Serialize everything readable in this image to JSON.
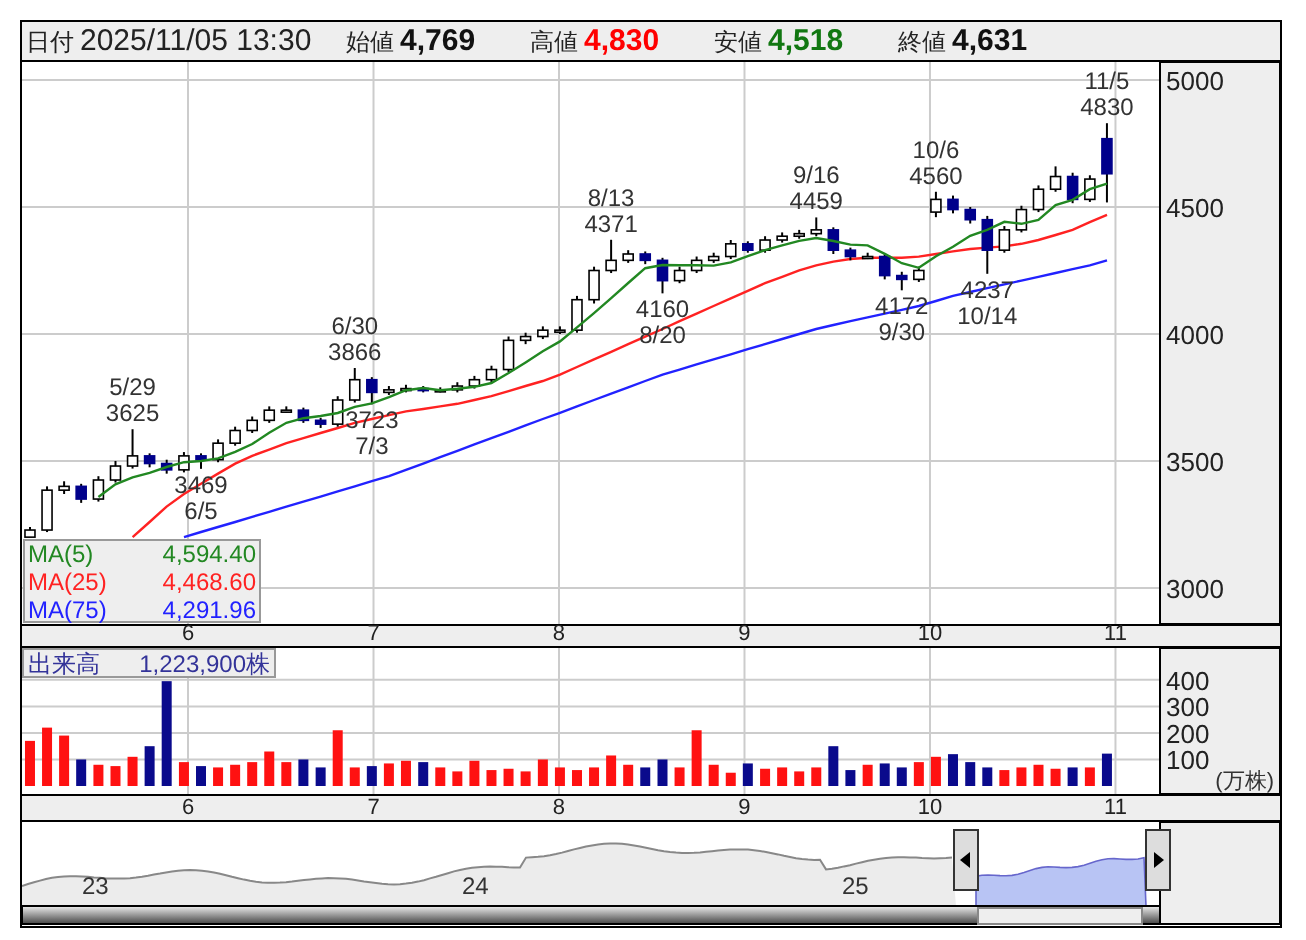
{
  "header": {
    "items": [
      {
        "kind": "date",
        "label": "日付",
        "value": "2025/11/05 13:30",
        "color": "#222222"
      },
      {
        "kind": "price",
        "label": "始値",
        "value": "4,769",
        "color": "#111111"
      },
      {
        "kind": "price",
        "label": "高値",
        "value": "4,830",
        "color": "#ff0000"
      },
      {
        "kind": "price",
        "label": "安値",
        "value": "4,518",
        "color": "#117711"
      },
      {
        "kind": "price",
        "label": "終値",
        "value": "4,631",
        "color": "#111111"
      }
    ]
  },
  "price_chart": {
    "legend_values": [
      "4,594.40",
      "4,468.60",
      "4,291.96"
    ],
    "chart_data": {
      "type": "candlestick",
      "grid": true,
      "ylim": [
        2858,
        5071
      ],
      "yticks": [
        {
          "value": 3000,
          "label": "3000"
        },
        {
          "value": 3500,
          "label": "3500"
        },
        {
          "value": 4000,
          "label": "4000"
        },
        {
          "value": 4500,
          "label": "4500"
        },
        {
          "value": 5000,
          "label": "5000"
        }
      ],
      "xlim": [
        5.105,
        11.887
      ],
      "xticks": [
        6,
        7,
        8,
        9,
        10,
        11
      ],
      "x": [
        5.148,
        5.24,
        5.332,
        5.424,
        5.517,
        5.609,
        5.701,
        5.793,
        5.885,
        5.978,
        6.07,
        6.162,
        6.254,
        6.346,
        6.438,
        6.53,
        6.622,
        6.715,
        6.807,
        6.899,
        6.991,
        7.083,
        7.175,
        7.268,
        7.36,
        7.452,
        7.544,
        7.636,
        7.728,
        7.82,
        7.913,
        8.005,
        8.097,
        8.189,
        8.281,
        8.373,
        8.465,
        8.558,
        8.65,
        8.742,
        8.834,
        8.926,
        9.018,
        9.111,
        9.203,
        9.295,
        9.387,
        9.479,
        9.571,
        9.664,
        9.756,
        9.848,
        9.94,
        10.032,
        10.124,
        10.217,
        10.309,
        10.401,
        10.493,
        10.585,
        10.677,
        10.769,
        10.862,
        10.954
      ],
      "ohlc": [
        [
          3200,
          3240,
          3200,
          3228
        ],
        [
          3228,
          3400,
          3220,
          3385
        ],
        [
          3385,
          3420,
          3370,
          3400
        ],
        [
          3400,
          3410,
          3335,
          3350
        ],
        [
          3350,
          3440,
          3340,
          3425
        ],
        [
          3425,
          3500,
          3415,
          3480
        ],
        [
          3480,
          3625,
          3470,
          3520
        ],
        [
          3520,
          3530,
          3475,
          3490
        ],
        [
          3490,
          3505,
          3450,
          3465
        ],
        [
          3465,
          3535,
          3455,
          3520
        ],
        [
          3520,
          3530,
          3469,
          3505
        ],
        [
          3505,
          3585,
          3495,
          3570
        ],
        [
          3570,
          3635,
          3560,
          3620
        ],
        [
          3620,
          3675,
          3610,
          3660
        ],
        [
          3660,
          3715,
          3650,
          3700
        ],
        [
          3700,
          3715,
          3690,
          3700
        ],
        [
          3700,
          3710,
          3650,
          3660
        ],
        [
          3660,
          3670,
          3630,
          3645
        ],
        [
          3645,
          3755,
          3635,
          3740
        ],
        [
          3740,
          3866,
          3730,
          3820
        ],
        [
          3820,
          3830,
          3723,
          3770
        ],
        [
          3770,
          3795,
          3760,
          3780
        ],
        [
          3780,
          3800,
          3770,
          3785
        ],
        [
          3785,
          3795,
          3770,
          3780
        ],
        [
          3780,
          3790,
          3770,
          3780
        ],
        [
          3780,
          3810,
          3770,
          3795
        ],
        [
          3795,
          3835,
          3785,
          3820
        ],
        [
          3820,
          3875,
          3810,
          3860
        ],
        [
          3860,
          3990,
          3850,
          3975
        ],
        [
          3975,
          4005,
          3960,
          3990
        ],
        [
          3990,
          4030,
          3980,
          4015
        ],
        [
          4015,
          4030,
          4000,
          4015
        ],
        [
          4015,
          4150,
          4005,
          4135
        ],
        [
          4135,
          4265,
          4120,
          4250
        ],
        [
          4250,
          4371,
          4240,
          4290
        ],
        [
          4290,
          4330,
          4280,
          4315
        ],
        [
          4315,
          4325,
          4275,
          4290
        ],
        [
          4290,
          4300,
          4160,
          4210
        ],
        [
          4210,
          4265,
          4200,
          4250
        ],
        [
          4250,
          4305,
          4240,
          4290
        ],
        [
          4290,
          4320,
          4280,
          4305
        ],
        [
          4305,
          4370,
          4295,
          4355
        ],
        [
          4355,
          4365,
          4320,
          4330
        ],
        [
          4330,
          4385,
          4320,
          4370
        ],
        [
          4370,
          4400,
          4360,
          4385
        ],
        [
          4385,
          4410,
          4375,
          4395
        ],
        [
          4395,
          4459,
          4385,
          4410
        ],
        [
          4410,
          4420,
          4315,
          4330
        ],
        [
          4330,
          4340,
          4290,
          4305
        ],
        [
          4305,
          4320,
          4295,
          4305
        ],
        [
          4305,
          4315,
          4215,
          4230
        ],
        [
          4230,
          4245,
          4172,
          4215
        ],
        [
          4215,
          4265,
          4205,
          4250
        ],
        [
          4480,
          4560,
          4460,
          4530
        ],
        [
          4530,
          4545,
          4475,
          4490
        ],
        [
          4490,
          4500,
          4435,
          4450
        ],
        [
          4450,
          4465,
          4237,
          4330
        ],
        [
          4330,
          4425,
          4320,
          4410
        ],
        [
          4410,
          4505,
          4400,
          4490
        ],
        [
          4490,
          4585,
          4480,
          4570
        ],
        [
          4570,
          4660,
          4560,
          4620
        ],
        [
          4620,
          4635,
          4515,
          4530
        ],
        [
          4530,
          4625,
          4520,
          4610
        ],
        [
          4769,
          4830,
          4518,
          4631
        ]
      ],
      "series": [
        {
          "name": "MA(5)",
          "type": "line",
          "color": "#228822",
          "x": [
            5.517,
            5.609,
            5.701,
            5.793,
            5.885,
            5.978,
            6.07,
            6.162,
            6.254,
            6.346,
            6.438,
            6.53,
            6.622,
            6.715,
            6.807,
            6.899,
            6.991,
            7.083,
            7.175,
            7.268,
            7.36,
            7.452,
            7.544,
            7.636,
            7.728,
            7.82,
            7.913,
            8.005,
            8.097,
            8.189,
            8.281,
            8.373,
            8.465,
            8.558,
            8.65,
            8.742,
            8.834,
            8.926,
            9.018,
            9.111,
            9.203,
            9.295,
            9.387,
            9.479,
            9.571,
            9.664,
            9.756,
            9.848,
            9.94,
            10.032,
            10.124,
            10.217,
            10.309,
            10.401,
            10.493,
            10.585,
            10.677,
            10.769,
            10.862,
            10.954
          ],
          "values": [
            3358,
            3408,
            3435,
            3453,
            3476,
            3495,
            3500,
            3510,
            3536,
            3567,
            3611,
            3650,
            3668,
            3677,
            3689,
            3713,
            3727,
            3751,
            3779,
            3787,
            3779,
            3784,
            3792,
            3807,
            3846,
            3888,
            3932,
            3971,
            4026,
            4082,
            4141,
            4201,
            4259,
            4272,
            4271,
            4271,
            4269,
            4282,
            4306,
            4330,
            4349,
            4367,
            4378,
            4366,
            4352,
            4349,
            4316,
            4279,
            4261,
            4306,
            4343,
            4387,
            4410,
            4442,
            4434,
            4450,
            4508,
            4528,
            4570,
            4592
          ]
        },
        {
          "name": "MA(25)",
          "type": "line",
          "color": "#ff2222",
          "x": [
            5.701,
            5.793,
            5.885,
            5.978,
            6.07,
            6.162,
            6.254,
            6.346,
            6.438,
            6.53,
            6.622,
            6.715,
            6.807,
            6.899,
            6.991,
            7.083,
            7.175,
            7.268,
            7.36,
            7.452,
            7.544,
            7.636,
            7.728,
            7.82,
            7.913,
            8.005,
            8.097,
            8.189,
            8.281,
            8.373,
            8.465,
            8.558,
            8.65,
            8.742,
            8.834,
            8.926,
            9.018,
            9.111,
            9.203,
            9.295,
            9.387,
            9.479,
            9.571,
            9.664,
            9.756,
            9.848,
            9.94,
            10.032,
            10.124,
            10.217,
            10.309,
            10.401,
            10.493,
            10.585,
            10.677,
            10.769,
            10.862,
            10.954
          ],
          "values": [
            3200,
            3260,
            3320,
            3370,
            3410,
            3450,
            3490,
            3520,
            3545,
            3570,
            3590,
            3610,
            3630,
            3650,
            3665,
            3680,
            3695,
            3705,
            3715,
            3725,
            3740,
            3755,
            3775,
            3795,
            3815,
            3840,
            3870,
            3900,
            3930,
            3960,
            3990,
            4020,
            4050,
            4080,
            4110,
            4140,
            4170,
            4200,
            4225,
            4250,
            4270,
            4285,
            4295,
            4300,
            4300,
            4300,
            4305,
            4315,
            4325,
            4335,
            4340,
            4345,
            4355,
            4370,
            4390,
            4410,
            4440,
            4469
          ]
        },
        {
          "name": "MA(75)",
          "type": "line",
          "color": "#2222ff",
          "x": [
            5.978,
            6.07,
            6.162,
            6.254,
            6.346,
            6.438,
            6.53,
            6.622,
            6.715,
            6.807,
            6.899,
            6.991,
            7.083,
            7.175,
            7.268,
            7.36,
            7.452,
            7.544,
            7.636,
            7.728,
            7.82,
            7.913,
            8.005,
            8.097,
            8.189,
            8.281,
            8.373,
            8.465,
            8.558,
            8.65,
            8.742,
            8.834,
            8.926,
            9.018,
            9.111,
            9.203,
            9.295,
            9.387,
            9.479,
            9.571,
            9.664,
            9.756,
            9.848,
            9.94,
            10.032,
            10.124,
            10.217,
            10.309,
            10.401,
            10.493,
            10.585,
            10.677,
            10.769,
            10.862,
            10.954
          ],
          "values": [
            3200,
            3220,
            3240,
            3260,
            3280,
            3300,
            3320,
            3340,
            3360,
            3380,
            3400,
            3420,
            3440,
            3465,
            3490,
            3515,
            3540,
            3565,
            3590,
            3615,
            3640,
            3665,
            3690,
            3715,
            3740,
            3765,
            3790,
            3815,
            3840,
            3860,
            3880,
            3900,
            3920,
            3940,
            3960,
            3980,
            4000,
            4020,
            4035,
            4050,
            4065,
            4080,
            4095,
            4110,
            4130,
            4150,
            4165,
            4180,
            4195,
            4210,
            4225,
            4240,
            4255,
            4270,
            4290
          ]
        }
      ],
      "annotations": [
        {
          "x": 5.701,
          "y": 3625,
          "text": "5/29"
        },
        {
          "x": 5.701,
          "y": 3625,
          "text": "3625"
        },
        {
          "x": 6.07,
          "y": 3469,
          "text": "3469"
        },
        {
          "x": 6.07,
          "y": 3469,
          "text": "6/5"
        },
        {
          "x": 6.899,
          "y": 3866,
          "text": "6/30"
        },
        {
          "x": 6.899,
          "y": 3866,
          "text": "3866"
        },
        {
          "x": 6.991,
          "y": 3723,
          "text": "3723"
        },
        {
          "x": 6.991,
          "y": 3723,
          "text": "7/3"
        },
        {
          "x": 8.281,
          "y": 4371,
          "text": "8/13"
        },
        {
          "x": 8.281,
          "y": 4371,
          "text": "4371"
        },
        {
          "x": 8.558,
          "y": 4160,
          "text": "4160"
        },
        {
          "x": 8.558,
          "y": 4160,
          "text": "8/20"
        },
        {
          "x": 9.387,
          "y": 4459,
          "text": "9/16"
        },
        {
          "x": 9.387,
          "y": 4459,
          "text": "4459"
        },
        {
          "x": 9.848,
          "y": 4172,
          "text": "4172"
        },
        {
          "x": 9.848,
          "y": 4172,
          "text": "9/30"
        },
        {
          "x": 10.032,
          "y": 4560,
          "text": "10/6"
        },
        {
          "x": 10.032,
          "y": 4560,
          "text": "4560"
        },
        {
          "x": 10.309,
          "y": 4237,
          "text": "4237"
        },
        {
          "x": 10.309,
          "y": 4237,
          "text": "10/14"
        },
        {
          "x": 10.954,
          "y": 4830,
          "text": "11/5"
        },
        {
          "x": 10.954,
          "y": 4830,
          "text": "4830"
        }
      ]
    }
  },
  "volume_chart": {
    "value": "1,223,900株",
    "unit": "(万株)",
    "chart_data": {
      "type": "bar",
      "grid": true,
      "ylim": [
        0,
        520
      ],
      "yticks": [
        {
          "value": 100,
          "label": "100"
        },
        {
          "value": 200,
          "label": "200"
        },
        {
          "value": 300,
          "label": "300"
        },
        {
          "value": 400,
          "label": "400"
        }
      ],
      "xlim": [
        5.105,
        11.887
      ],
      "xticks": [
        6,
        7,
        8,
        9,
        10,
        11
      ],
      "x": [
        5.148,
        5.24,
        5.332,
        5.424,
        5.517,
        5.609,
        5.701,
        5.793,
        5.885,
        5.978,
        6.07,
        6.162,
        6.254,
        6.346,
        6.438,
        6.53,
        6.622,
        6.715,
        6.807,
        6.899,
        6.991,
        7.083,
        7.175,
        7.268,
        7.36,
        7.452,
        7.544,
        7.636,
        7.728,
        7.82,
        7.913,
        8.005,
        8.097,
        8.189,
        8.281,
        8.373,
        8.465,
        8.558,
        8.65,
        8.742,
        8.834,
        8.926,
        9.018,
        9.111,
        9.203,
        9.295,
        9.387,
        9.479,
        9.571,
        9.664,
        9.756,
        9.848,
        9.94,
        10.032,
        10.124,
        10.217,
        10.309,
        10.401,
        10.493,
        10.585,
        10.677,
        10.769,
        10.862,
        10.954
      ],
      "series": [
        {
          "name": "出来高",
          "values": [
            170,
            220,
            190,
            100,
            80,
            75,
            110,
            150,
            395,
            90,
            75,
            70,
            80,
            90,
            130,
            90,
            100,
            70,
            210,
            70,
            75,
            85,
            95,
            90,
            70,
            55,
            95,
            60,
            65,
            55,
            100,
            70,
            60,
            70,
            115,
            80,
            70,
            100,
            70,
            210,
            80,
            50,
            85,
            65,
            70,
            55,
            70,
            150,
            60,
            80,
            85,
            70,
            90,
            110,
            120,
            90,
            70,
            60,
            70,
            80,
            65,
            70,
            70,
            122
          ]
        }
      ]
    }
  },
  "navigator": {
    "year_labels": [
      "23",
      "24",
      "25"
    ]
  }
}
